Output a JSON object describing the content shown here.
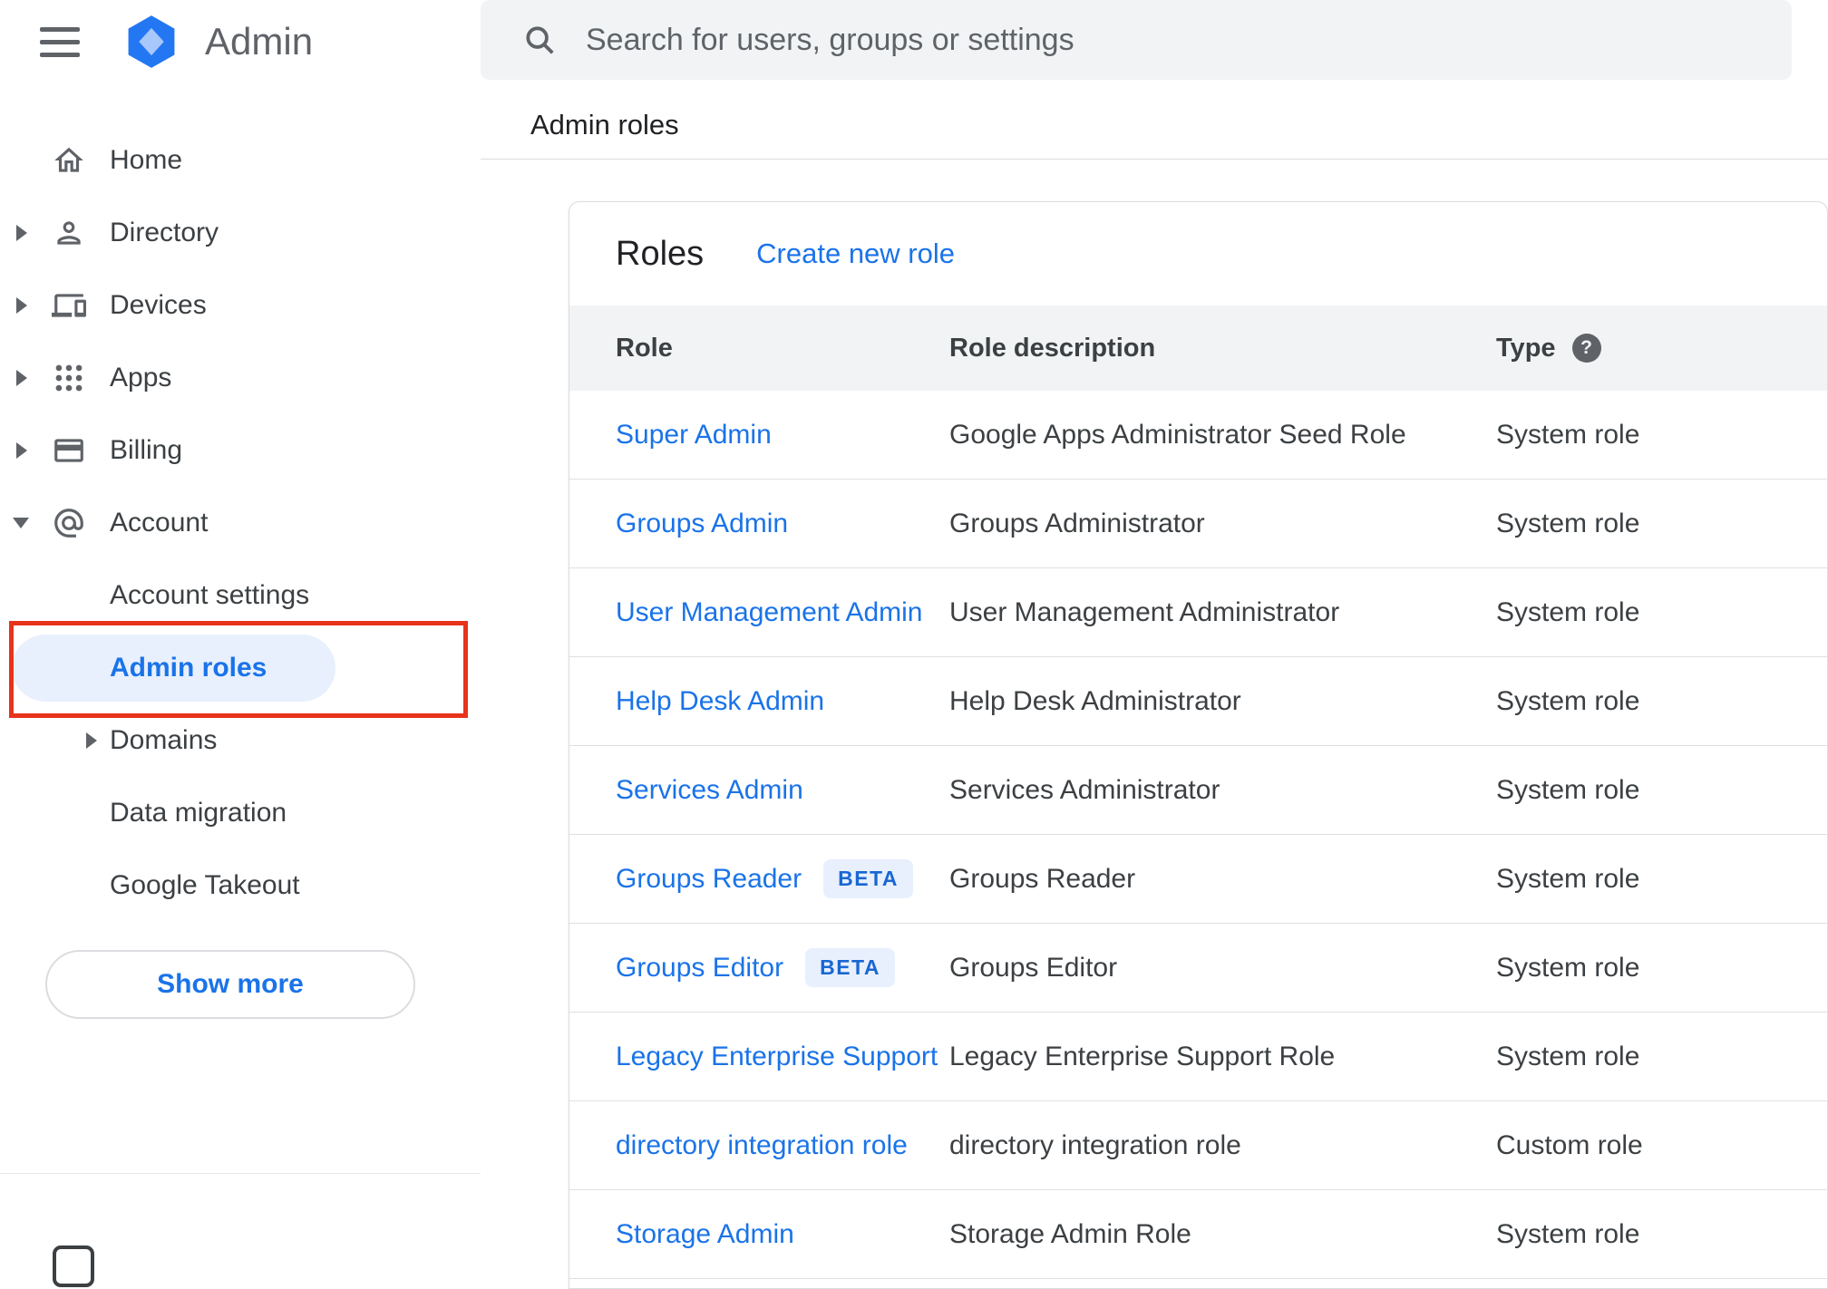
{
  "header": {
    "app_title": "Admin"
  },
  "search": {
    "placeholder": "Search for users, groups or settings"
  },
  "page": {
    "breadcrumb": "Admin roles"
  },
  "sidebar": {
    "items": [
      {
        "label": "Home",
        "icon": "home"
      },
      {
        "label": "Directory",
        "icon": "person",
        "expandable": true
      },
      {
        "label": "Devices",
        "icon": "devices",
        "expandable": true
      },
      {
        "label": "Apps",
        "icon": "apps-grid",
        "expandable": true
      },
      {
        "label": "Billing",
        "icon": "credit-card",
        "expandable": true
      },
      {
        "label": "Account",
        "icon": "at-sign",
        "expanded": true
      },
      {
        "label": "Account settings"
      },
      {
        "label": "Admin roles",
        "selected": true
      },
      {
        "label": "Domains",
        "expandable": true
      },
      {
        "label": "Data migration"
      },
      {
        "label": "Google Takeout"
      }
    ],
    "show_more": "Show more"
  },
  "roles_card": {
    "title": "Roles",
    "create_link": "Create new role",
    "columns": [
      "Role",
      "Role description",
      "Type"
    ],
    "rows": [
      {
        "role": "Super Admin",
        "beta": "",
        "description": "Google Apps Administrator Seed Role",
        "type": "System role"
      },
      {
        "role": "Groups Admin",
        "beta": "",
        "description": "Groups Administrator",
        "type": "System role"
      },
      {
        "role": "User Management Admin",
        "beta": "",
        "description": "User Management Administrator",
        "type": "System role"
      },
      {
        "role": "Help Desk Admin",
        "beta": "",
        "description": "Help Desk Administrator",
        "type": "System role"
      },
      {
        "role": "Services Admin",
        "beta": "",
        "description": "Services Administrator",
        "type": "System role"
      },
      {
        "role": "Groups Reader",
        "beta": "BETA",
        "description": "Groups Reader",
        "type": "System role"
      },
      {
        "role": "Groups Editor",
        "beta": "BETA",
        "description": "Groups Editor",
        "type": "System role"
      },
      {
        "role": "Legacy Enterprise Support",
        "beta": "",
        "description": "Legacy Enterprise Support Role",
        "type": "System role"
      },
      {
        "role": "directory integration role",
        "beta": "",
        "description": "directory integration role",
        "type": "Custom role"
      },
      {
        "role": "Storage Admin",
        "beta": "",
        "description": "Storage Admin Role",
        "type": "System role"
      }
    ]
  },
  "colors": {
    "accent_blue": "#1a73e8",
    "selected_item_bg": "#e8f0fe",
    "annotation_red": "#e8331c",
    "beta_badge_bg": "#e8f0fe",
    "beta_badge_text": "#1967d2",
    "table_header_bg": "#f1f3f4"
  }
}
